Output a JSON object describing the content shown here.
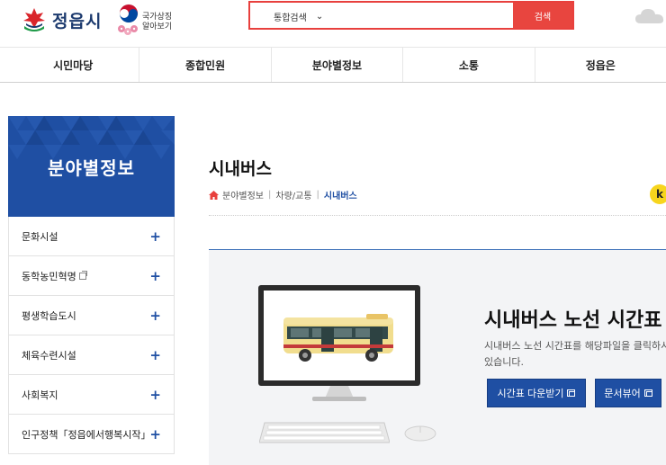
{
  "header": {
    "logo_text": "정읍시",
    "symbol_line1": "국가상징",
    "symbol_line2": "알아보기",
    "search": {
      "select_value": "통합검색",
      "input_value": "",
      "button_label": "검색"
    }
  },
  "gnb": {
    "items": [
      {
        "label": "시민마당"
      },
      {
        "label": "종합민원"
      },
      {
        "label": "분야별정보"
      },
      {
        "label": "소통"
      },
      {
        "label": "정읍은"
      }
    ]
  },
  "sidebar": {
    "title": "분야별정보",
    "items": [
      {
        "label": "문화시설",
        "external": false
      },
      {
        "label": "동학농민혁명",
        "external": true
      },
      {
        "label": "평생학습도시",
        "external": false
      },
      {
        "label": "체육수련시설",
        "external": false
      },
      {
        "label": "사회복지",
        "external": false
      },
      {
        "label": "인구정책「정읍에서행복시작」",
        "external": false
      }
    ]
  },
  "content": {
    "page_title": "시내버스",
    "breadcrumb": [
      "분야별정보",
      "차량/교통",
      "시내버스"
    ],
    "badge": "k",
    "banner": {
      "title": "시내버스 노선 시간표",
      "desc_line1": "시내버스 노선 시간표를 해당파일을 클릭하시",
      "desc_line2": "있습니다.",
      "download_label": "시간표 다운받기",
      "viewer_label": "문서뷰어"
    }
  },
  "colors": {
    "accent_blue": "#1f4fa3",
    "search_red": "#e8453f",
    "badge_yellow": "#f7d51d"
  }
}
